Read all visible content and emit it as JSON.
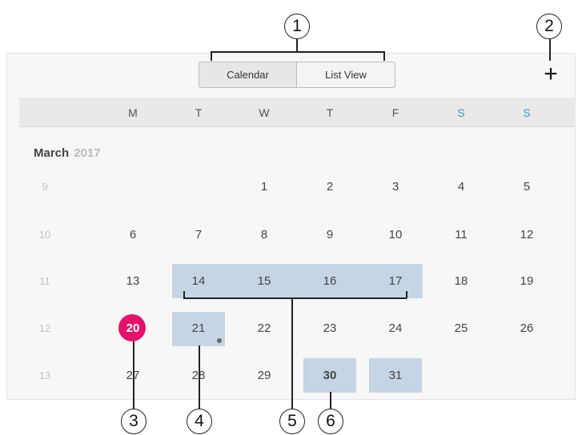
{
  "view_switcher": {
    "calendar_label": "Calendar",
    "list_label": "List View",
    "selected": "Calendar"
  },
  "add_button": {
    "icon": "plus-icon",
    "label": "+"
  },
  "weekdays": [
    "M",
    "T",
    "W",
    "T",
    "F",
    "S",
    "S"
  ],
  "month_header": {
    "month": "March",
    "year": "2017"
  },
  "weeks": [
    {
      "week": "9",
      "days": [
        "",
        "",
        "1",
        "2",
        "3",
        "4",
        "5"
      ]
    },
    {
      "week": "10",
      "days": [
        "6",
        "7",
        "8",
        "9",
        "10",
        "11",
        "12"
      ]
    },
    {
      "week": "11",
      "days": [
        "13",
        "14",
        "15",
        "16",
        "17",
        "18",
        "19"
      ]
    },
    {
      "week": "12",
      "days": [
        "20",
        "21",
        "22",
        "23",
        "24",
        "25",
        "26"
      ]
    },
    {
      "week": "13",
      "days": [
        "27",
        "28",
        "29",
        "30",
        "31",
        "",
        ""
      ]
    }
  ],
  "today": "20",
  "highlighted_days": [
    "14",
    "15",
    "16",
    "17",
    "21",
    "30",
    "31"
  ],
  "days_with_event_dot": [
    "21"
  ],
  "bold_day": "30",
  "colors": {
    "today": "#e3126a",
    "selection": "#c5d5e5",
    "weekend": "#3c94d8"
  },
  "callouts": [
    "1",
    "2",
    "3",
    "4",
    "5",
    "6"
  ]
}
